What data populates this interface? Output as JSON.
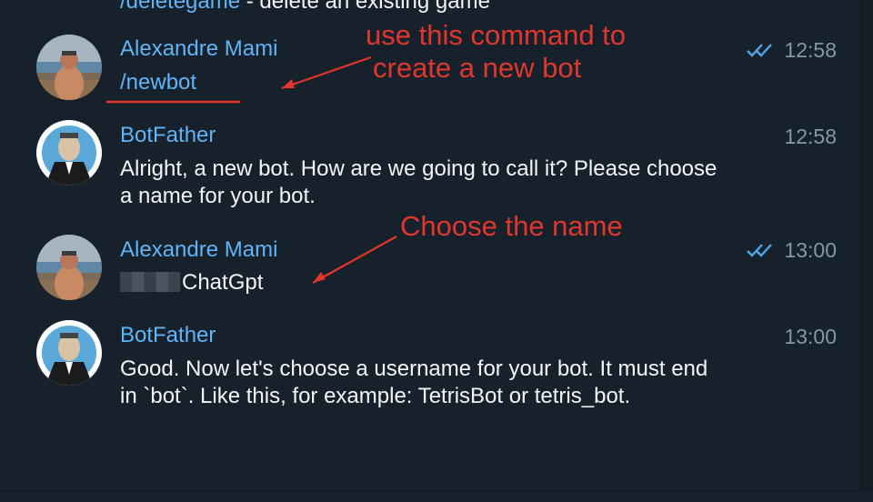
{
  "chat": {
    "cut_off_line": {
      "command": "/deletegame",
      "separator": " - ",
      "description": "delete an existing game"
    },
    "messages": [
      {
        "sender": "Alexandre Mami",
        "text": "/newbot",
        "time": "12:58",
        "read": true
      },
      {
        "sender": "BotFather",
        "text": "Alright, a new bot. How are we going to call it? Please choose a name for your bot.",
        "time": "12:58"
      },
      {
        "sender": "Alexandre Mami",
        "text": "ChatGpt",
        "time": "13:00",
        "read": true
      },
      {
        "sender": "BotFather",
        "text": "Good. Now let's choose a username for your bot. It must end in `bot`. Like this, for example: TetrisBot or tetris_bot.",
        "time": "13:00"
      }
    ]
  },
  "annotations": {
    "first_line1": "use this command to",
    "first_line2": "create a new bot",
    "second": "Choose the name"
  },
  "colors": {
    "background": "#17212b",
    "sender_name": "#5eb5f7",
    "timestamp": "#8696a6",
    "annotation": "#e0362c"
  }
}
